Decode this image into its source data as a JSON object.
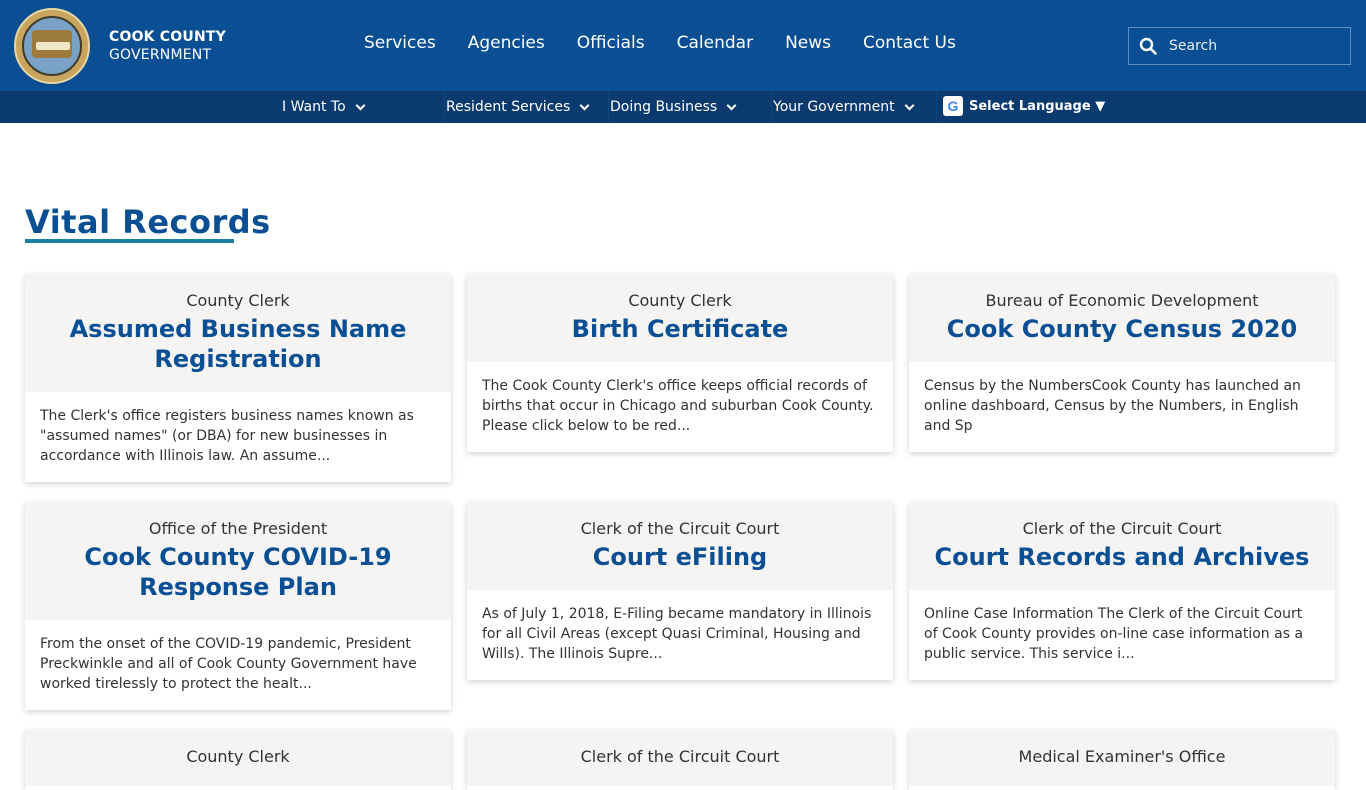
{
  "header": {
    "brand_line1": "COOK COUNTY",
    "brand_line2": "GOVERNMENT",
    "nav": [
      "Services",
      "Agencies",
      "Officials",
      "Calendar",
      "News",
      "Contact Us"
    ],
    "search_placeholder": "Search"
  },
  "subnav": {
    "items": [
      "I Want To",
      "Resident Services",
      "Doing Business",
      "Your Government"
    ],
    "language": "Select Language ▼"
  },
  "page": {
    "title": "Vital Records"
  },
  "cards": [
    {
      "agency": "County Clerk",
      "title": "Assumed Business Name Registration",
      "desc": "The Clerk's office registers business names known as \"assumed names\" (or DBA) for new businesses in accordance with Illinois law. An assume..."
    },
    {
      "agency": "County Clerk",
      "title": "Birth Certificate",
      "desc": "The Cook County Clerk's office keeps official records of births that occur in Chicago and suburban Cook County. Please click below to be red..."
    },
    {
      "agency": "Bureau of Economic Development",
      "title": "Cook County Census 2020",
      "desc": "Census by the NumbersCook County has launched an online dashboard, Census by the Numbers, in English and Sp"
    },
    {
      "agency": "Office of the President",
      "title": "Cook County COVID-19 Response Plan",
      "desc": "From the onset of the COVID-19 pandemic, President Preckwinkle and all of Cook County Government have worked tirelessly to protect the healt..."
    },
    {
      "agency": "Clerk of the Circuit Court",
      "title": "Court eFiling",
      "desc": "As of July 1, 2018, E-Filing became mandatory in Illinois for all Civil Areas (except Quasi Criminal, Housing and Wills). The Illinois Supre..."
    },
    {
      "agency": "Clerk of the Circuit Court",
      "title": "Court Records and Archives",
      "desc": "Online Case Information The Clerk of the Circuit Court of Cook County provides on-line case information as a public service. This service i..."
    },
    {
      "agency": "County Clerk",
      "title": "",
      "desc": ""
    },
    {
      "agency": "Clerk of the Circuit Court",
      "title": "",
      "desc": ""
    },
    {
      "agency": "Medical Examiner's Office",
      "title": "",
      "desc": ""
    }
  ],
  "colors": {
    "header_blue": "#0a4f93",
    "subnav_blue": "#0b3b6e",
    "title_blue": "#0a4f93",
    "underline_teal": "#1a7fa0",
    "card_head_bg": "#f5f4f2"
  }
}
